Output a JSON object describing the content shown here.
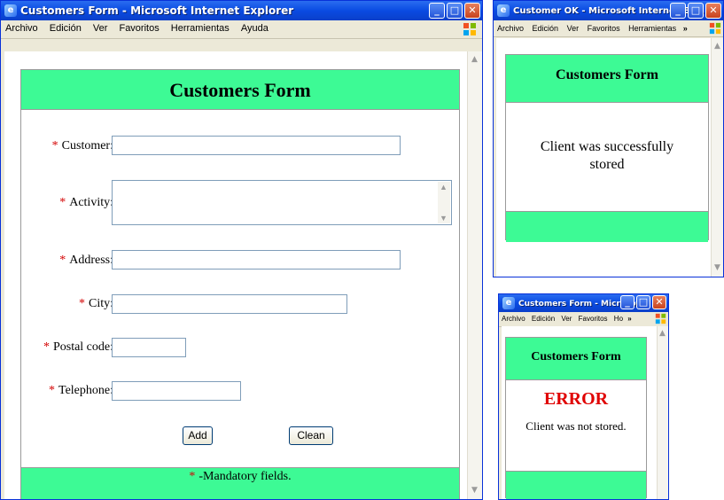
{
  "menu": [
    "Archivo",
    "Edición",
    "Ver",
    "Favoritos",
    "Herramientas",
    "Ayuda"
  ],
  "colors": {
    "header_green": "#3dfa95",
    "required_red": "#d40000",
    "error_red": "#e00000",
    "titlebar_blue": "#0a4be2"
  },
  "main": {
    "window_title": "Customers Form - Microsoft Internet Explorer",
    "heading": "Customers Form",
    "fields": [
      {
        "label": "Customer:",
        "value": ""
      },
      {
        "label": "Activity:",
        "value": ""
      },
      {
        "label": "Address:",
        "value": ""
      },
      {
        "label": "City:",
        "value": ""
      },
      {
        "label": "Postal code:",
        "value": ""
      },
      {
        "label": "Telephone:",
        "value": ""
      }
    ],
    "add_label": "Add",
    "clean_label": "Clean",
    "footer_asterisk": "*",
    "footer_text": "-Mandatory fields."
  },
  "ok_window": {
    "title": "Customer OK - Microsoft Internet Ex...",
    "menu_visible": [
      "Archivo",
      "Edición",
      "Ver",
      "Favoritos",
      "Herramientas"
    ],
    "menu_more": "»",
    "heading": "Customers Form",
    "message": "Client was successfully stored"
  },
  "error_window": {
    "title": "Customers Form - Microsof...",
    "menu_visible": [
      "Archivo",
      "Edición",
      "Ver",
      "Favoritos",
      "Ho"
    ],
    "menu_more": "»",
    "heading": "Customers Form",
    "error_title": "ERROR",
    "message": "Client was not stored."
  },
  "icons": {
    "minimize": "minimize-icon",
    "maximize": "maximize-icon",
    "close": "close-icon",
    "ie": "ie-icon",
    "windows_flag": "windows-flag-icon"
  }
}
